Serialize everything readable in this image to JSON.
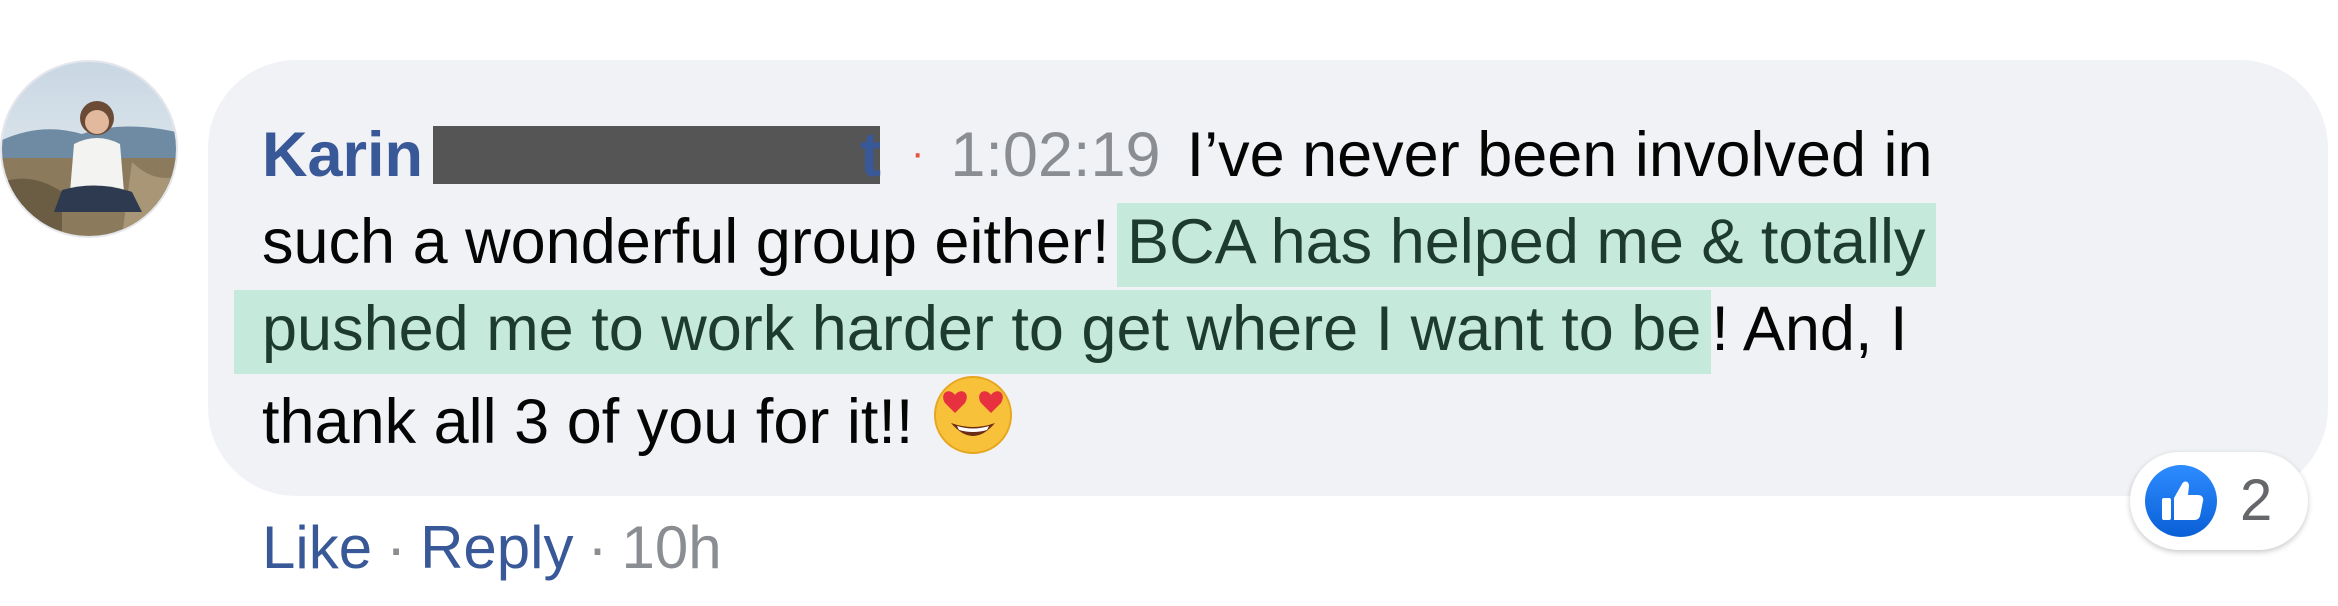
{
  "comment": {
    "author_first": "Karin",
    "author_partial": "t",
    "separator": "·",
    "timestamp": "1:02:19",
    "text_line1": "I’ve never been involved in",
    "text_line2_plain": "such a wonderful group either!",
    "text_line2_highlight": "BCA has helped me & totally",
    "text_line3_highlight": "pushed me to work harder to get where I want to be",
    "text_line3_plain": "! And, I",
    "text_line4": "thank all 3 of you for it!!",
    "emoji": "heart-eyes-emoji"
  },
  "actions": {
    "like_label": "Like",
    "dot1": "·",
    "reply_label": "Reply",
    "dot2": "·",
    "age": "10h"
  },
  "reactions": {
    "icon": "like-thumbs-up-icon",
    "count": "2"
  },
  "colors": {
    "bubble": "#f0f2f5",
    "author": "#385898",
    "highlight": "#c5e9da",
    "like_blue": "#1877f2",
    "redaction": "#555555"
  }
}
